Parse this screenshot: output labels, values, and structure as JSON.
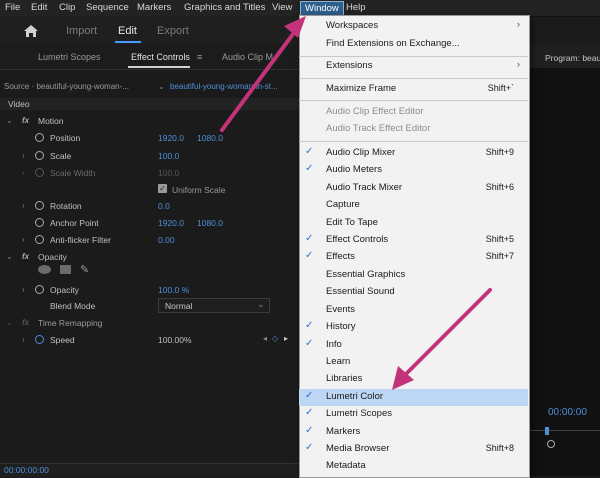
{
  "menubar": [
    "File",
    "Edit",
    "Clip",
    "Sequence",
    "Markers",
    "Graphics and Titles",
    "View",
    "Window",
    "Help"
  ],
  "workspace_tabs": {
    "import": "Import",
    "edit": "Edit",
    "export": "Export"
  },
  "panel_tabs": {
    "lumetri": "Lumetri Scopes",
    "effect_controls": "Effect Controls",
    "effect_controls_icon": "≡",
    "audio": "Audio Clip M"
  },
  "source": {
    "label": "Source · beautiful-young-woman-...",
    "target": "beautiful-young-woman-in-st..."
  },
  "section_video": "Video",
  "motion": {
    "title": "Motion",
    "position": {
      "label": "Position",
      "x": "1920.0",
      "y": "1080.0"
    },
    "scale": {
      "label": "Scale",
      "value": "100.0"
    },
    "scale_width": {
      "label": "Scale Width",
      "value": "100.0"
    },
    "uniform": "Uniform Scale",
    "rotation": {
      "label": "Rotation",
      "value": "0.0"
    },
    "anchor": {
      "label": "Anchor Point",
      "x": "1920.0",
      "y": "1080.0"
    },
    "antiflicker": {
      "label": "Anti-flicker Filter",
      "value": "0.00"
    }
  },
  "opacity": {
    "title": "Opacity",
    "label": "Opacity",
    "value": "100.0 %",
    "blend_label": "Blend Mode",
    "blend_value": "Normal"
  },
  "time_remap": {
    "title": "Time Remapping",
    "speed_label": "Speed",
    "speed_value": "100.00%"
  },
  "timecode": "00:00:00:00",
  "program": {
    "title": "Program: beau",
    "timecode": "00:00:00"
  },
  "menu": {
    "items": [
      {
        "label": "Workspaces",
        "submenu": true
      },
      {
        "label": "Find Extensions on Exchange..."
      },
      {
        "label": "Extensions",
        "submenu": true
      },
      {
        "label": "Maximize Frame",
        "shortcut": "Shift+`"
      },
      {
        "label": "Audio Clip Effect Editor",
        "disabled": true
      },
      {
        "label": "Audio Track Effect Editor",
        "disabled": true
      },
      {
        "label": "Audio Clip Mixer",
        "shortcut": "Shift+9",
        "checked": true
      },
      {
        "label": "Audio Meters",
        "checked": true
      },
      {
        "label": "Audio Track Mixer",
        "shortcut": "Shift+6"
      },
      {
        "label": "Capture"
      },
      {
        "label": "Edit To Tape"
      },
      {
        "label": "Effect Controls",
        "shortcut": "Shift+5",
        "checked": true
      },
      {
        "label": "Effects",
        "shortcut": "Shift+7",
        "checked": true
      },
      {
        "label": "Essential Graphics"
      },
      {
        "label": "Essential Sound"
      },
      {
        "label": "Events"
      },
      {
        "label": "History",
        "checked": true
      },
      {
        "label": "Info",
        "checked": true
      },
      {
        "label": "Learn"
      },
      {
        "label": "Libraries"
      },
      {
        "label": "Lumetri Color",
        "checked": true
      },
      {
        "label": "Lumetri Scopes",
        "checked": true
      },
      {
        "label": "Markers",
        "checked": true
      },
      {
        "label": "Media Browser",
        "shortcut": "Shift+8",
        "checked": true
      },
      {
        "label": "Metadata"
      }
    ]
  },
  "colors": {
    "accent": "#4a9bff",
    "highlight": "#bcd6f3",
    "arrow": "#c2337a"
  }
}
